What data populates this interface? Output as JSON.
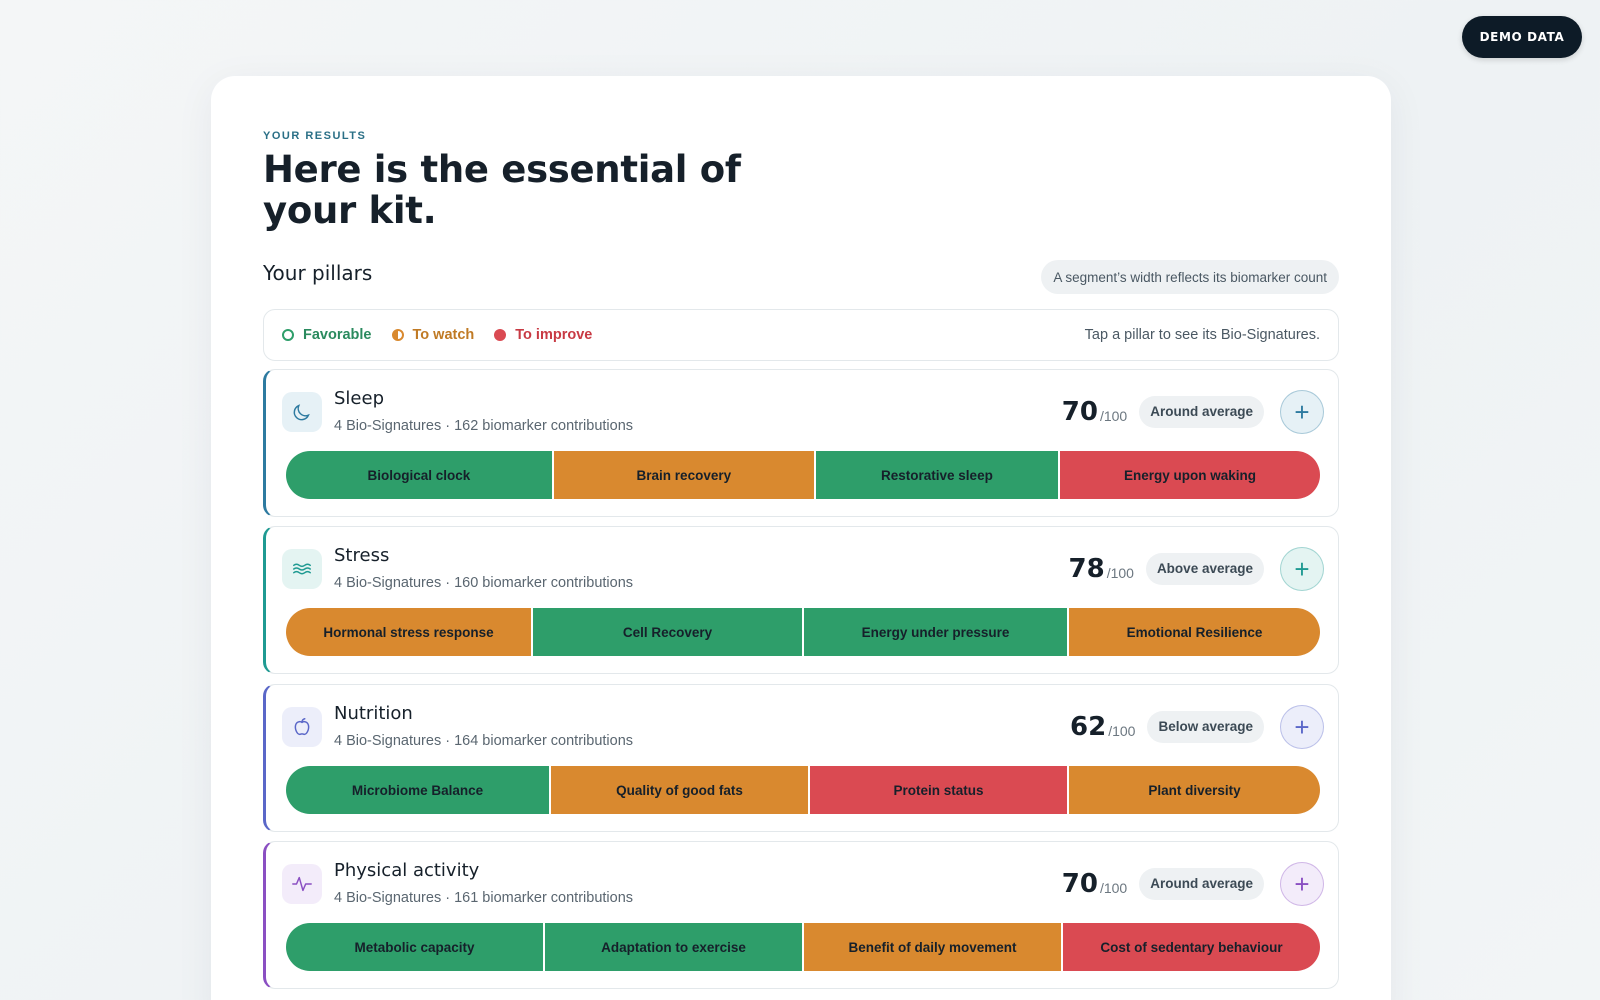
{
  "badge": "DEMO DATA",
  "eyebrow": "YOUR RESULTS",
  "title": "Here is the essential of your kit.",
  "section_title": "Your pillars",
  "hint": "A segment’s width reflects its biomarker count",
  "legend": {
    "favorable": "Favorable",
    "to_watch": "To watch",
    "to_improve": "To improve",
    "hint": "Tap a pillar to see its Bio-Signatures."
  },
  "colors": {
    "favorable": "#2e9e6a",
    "to_watch": "#d9892f",
    "to_improve": "#da4a52"
  },
  "pillars": [
    {
      "name": "Sleep",
      "icon": "moon-icon",
      "accent": "#2d7aa0",
      "icon_bg": "#e6f1f6",
      "meta": "4 Bio-Signatures · 162 biomarker contributions",
      "score": "70",
      "denominator": "/100",
      "rating": "Around average",
      "segments": [
        {
          "label": "Biological clock",
          "status": "favorable",
          "weight": 45
        },
        {
          "label": "Brain recovery",
          "status": "to_watch",
          "weight": 44
        },
        {
          "label": "Restorative sleep",
          "status": "favorable",
          "weight": 41
        },
        {
          "label": "Energy upon waking",
          "status": "to_improve",
          "weight": 44
        }
      ]
    },
    {
      "name": "Stress",
      "icon": "waves-icon",
      "accent": "#1f9a92",
      "icon_bg": "#e4f4f2",
      "meta": "4 Bio-Signatures · 160 biomarker contributions",
      "score": "78",
      "denominator": "/100",
      "rating": "Above average",
      "segments": [
        {
          "label": "Hormonal stress response",
          "status": "to_watch",
          "weight": 41
        },
        {
          "label": "Cell Recovery",
          "status": "favorable",
          "weight": 45
        },
        {
          "label": "Energy under pressure",
          "status": "favorable",
          "weight": 44
        },
        {
          "label": "Emotional Resilience",
          "status": "to_watch",
          "weight": 42
        }
      ]
    },
    {
      "name": "Nutrition",
      "icon": "apple-icon",
      "accent": "#5a67c8",
      "icon_bg": "#eceefa",
      "meta": "4 Bio-Signatures · 164 biomarker contributions",
      "score": "62",
      "denominator": "/100",
      "rating": "Below average",
      "segments": [
        {
          "label": "Microbiome Balance",
          "status": "favorable",
          "weight": 44
        },
        {
          "label": "Quality of good fats",
          "status": "to_watch",
          "weight": 43
        },
        {
          "label": "Protein status",
          "status": "to_improve",
          "weight": 43
        },
        {
          "label": "Plant diversity",
          "status": "to_watch",
          "weight": 42
        }
      ]
    },
    {
      "name": "Physical activity",
      "icon": "pulse-icon",
      "accent": "#8a4fc2",
      "icon_bg": "#f3ecfa",
      "meta": "4 Bio-Signatures · 161 biomarker contributions",
      "score": "70",
      "denominator": "/100",
      "rating": "Around average",
      "segments": [
        {
          "label": "Metabolic capacity",
          "status": "favorable",
          "weight": 43
        },
        {
          "label": "Adaptation to exercise",
          "status": "favorable",
          "weight": 43
        },
        {
          "label": "Benefit of daily movement",
          "status": "to_watch",
          "weight": 43
        },
        {
          "label": "Cost of sedentary behaviour",
          "status": "to_improve",
          "weight": 43
        }
      ]
    }
  ]
}
